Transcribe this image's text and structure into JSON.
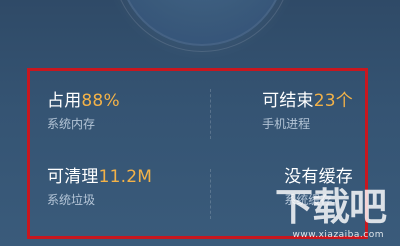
{
  "stats": {
    "occupied": {
      "label": "占用",
      "value": "88%",
      "sub": "系统内存"
    },
    "killable": {
      "label": "可结束",
      "value": "23个",
      "sub": "手机进程"
    },
    "cleanable": {
      "label": "可清理",
      "value": "11.2M",
      "sub": "系统垃圾"
    },
    "cache": {
      "label": "没有缓存",
      "sub": "系统缓存"
    }
  },
  "watermark": {
    "logo": "下载吧",
    "url": "www.xiazaiba.com"
  },
  "colors": {
    "background": "#355473",
    "accent": "#f3b248",
    "highlight_border": "#c8171f",
    "text": "#ffffff"
  }
}
